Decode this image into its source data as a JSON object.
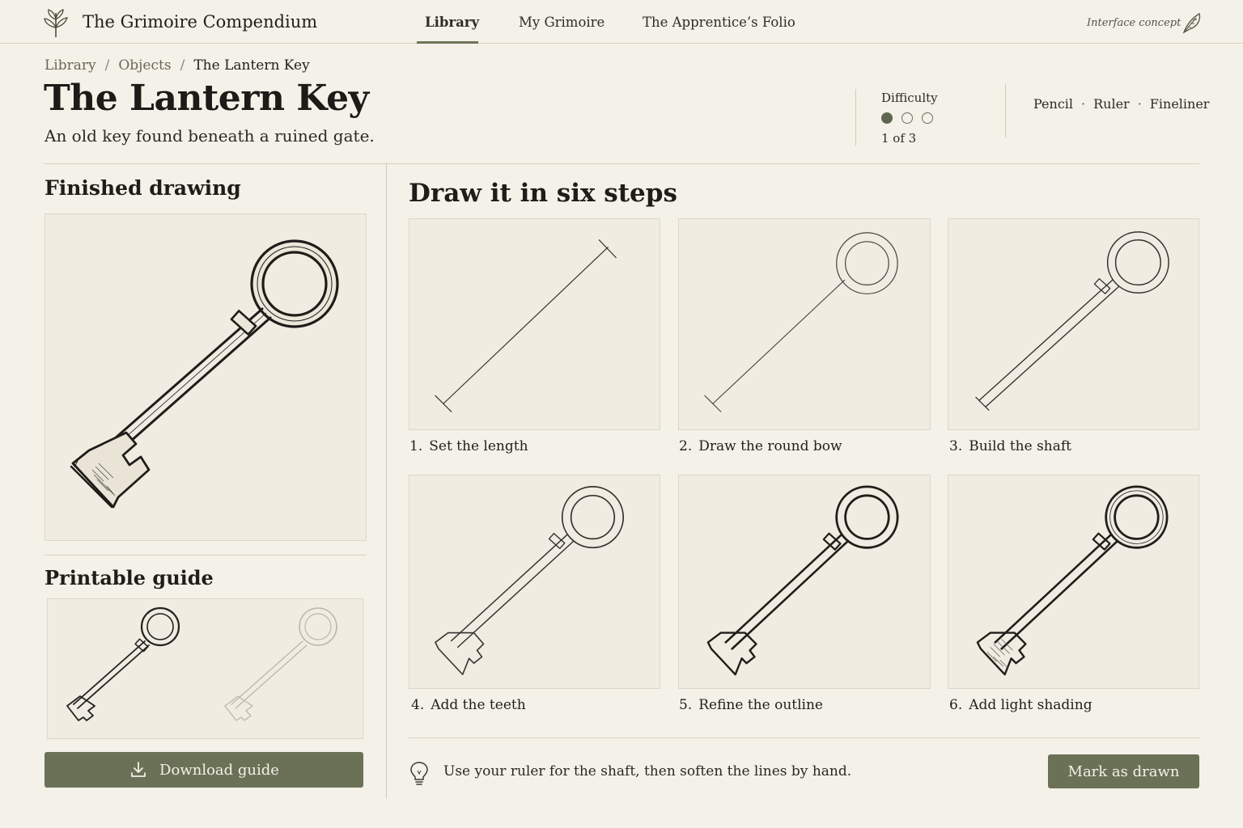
{
  "app": {
    "name": "The Grimoire Compendium",
    "concept_label": "Interface concept"
  },
  "nav": [
    {
      "label": "Library",
      "active": true
    },
    {
      "label": "My Grimoire",
      "active": false
    },
    {
      "label": "The Apprentice’s Folio",
      "active": false
    }
  ],
  "breadcrumb": {
    "items": [
      "Library",
      "Objects"
    ],
    "current": "The Lantern Key",
    "separator": "/"
  },
  "page": {
    "title": "The Lantern Key",
    "subtitle": "An old key found beneath a ruined gate."
  },
  "difficulty": {
    "label": "Difficulty",
    "level": 1,
    "max": 3,
    "text": "1 of 3"
  },
  "tools": [
    "Pencil",
    "Ruler",
    "Fineliner"
  ],
  "finished": {
    "heading": "Finished drawing"
  },
  "guide": {
    "heading": "Printable guide",
    "download_label": "Download guide"
  },
  "steps_section": {
    "heading": "Draw it in six steps",
    "steps": [
      {
        "num": "1.",
        "label": "Set the length"
      },
      {
        "num": "2.",
        "label": "Draw the round bow"
      },
      {
        "num": "3.",
        "label": "Build the shaft"
      },
      {
        "num": "4.",
        "label": "Add the teeth"
      },
      {
        "num": "5.",
        "label": "Refine the outline"
      },
      {
        "num": "6.",
        "label": "Add light shading"
      }
    ]
  },
  "tip": {
    "text": "Use your ruler for the shaft, then soften the lines by hand."
  },
  "actions": {
    "mark_label": "Mark as drawn"
  },
  "colors": {
    "background": "#f4f1e8",
    "accent": "#6a7157",
    "panel": "#f0ece1"
  }
}
